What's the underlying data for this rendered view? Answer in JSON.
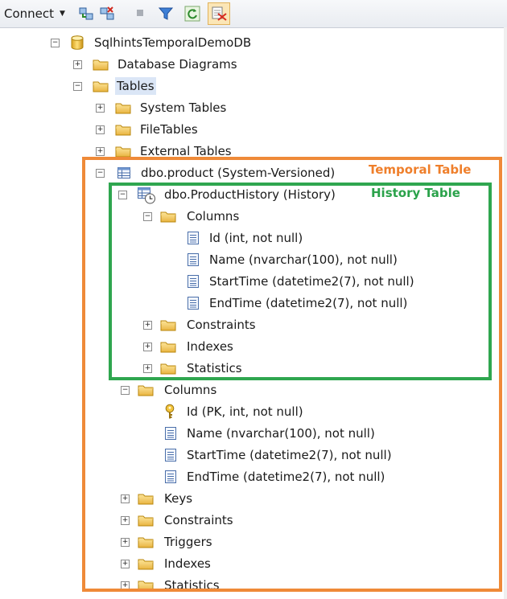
{
  "toolbar": {
    "connect_label": "Connect",
    "buttons": [
      {
        "name": "connect-object-explorer-icon"
      },
      {
        "name": "disconnect-icon"
      },
      {
        "name": "stop-icon"
      },
      {
        "name": "filter-icon"
      },
      {
        "name": "refresh-icon"
      },
      {
        "name": "activity-monitor-icon"
      }
    ]
  },
  "tree": {
    "database": "SqlhintsTemporalDemoDB",
    "database_diagrams": "Database Diagrams",
    "tables": "Tables",
    "system_tables": "System Tables",
    "file_tables": "FileTables",
    "external_tables": "External Tables",
    "product_table": "dbo.product (System-Versioned)",
    "history_table": "dbo.ProductHistory (History)",
    "history_columns_folder": "Columns",
    "history_columns": [
      "Id (int, not null)",
      "Name (nvarchar(100), not null)",
      "StartTime (datetime2(7), not null)",
      "EndTime (datetime2(7), not null)"
    ],
    "history_constraints": "Constraints",
    "history_indexes": "Indexes",
    "history_statistics": "Statistics",
    "product_columns_folder": "Columns",
    "product_columns": [
      "Id (PK, int, not null)",
      "Name (nvarchar(100), not null)",
      "StartTime (datetime2(7), not null)",
      "EndTime (datetime2(7), not null)"
    ],
    "product_keys": "Keys",
    "product_constraints": "Constraints",
    "product_triggers": "Triggers",
    "product_indexes": "Indexes",
    "product_statistics": "Statistics"
  },
  "annotations": {
    "temporal_label": "Temporal Table",
    "history_label": "History Table",
    "temporal_color": "#ef8a38",
    "history_color": "#2fa64f"
  }
}
